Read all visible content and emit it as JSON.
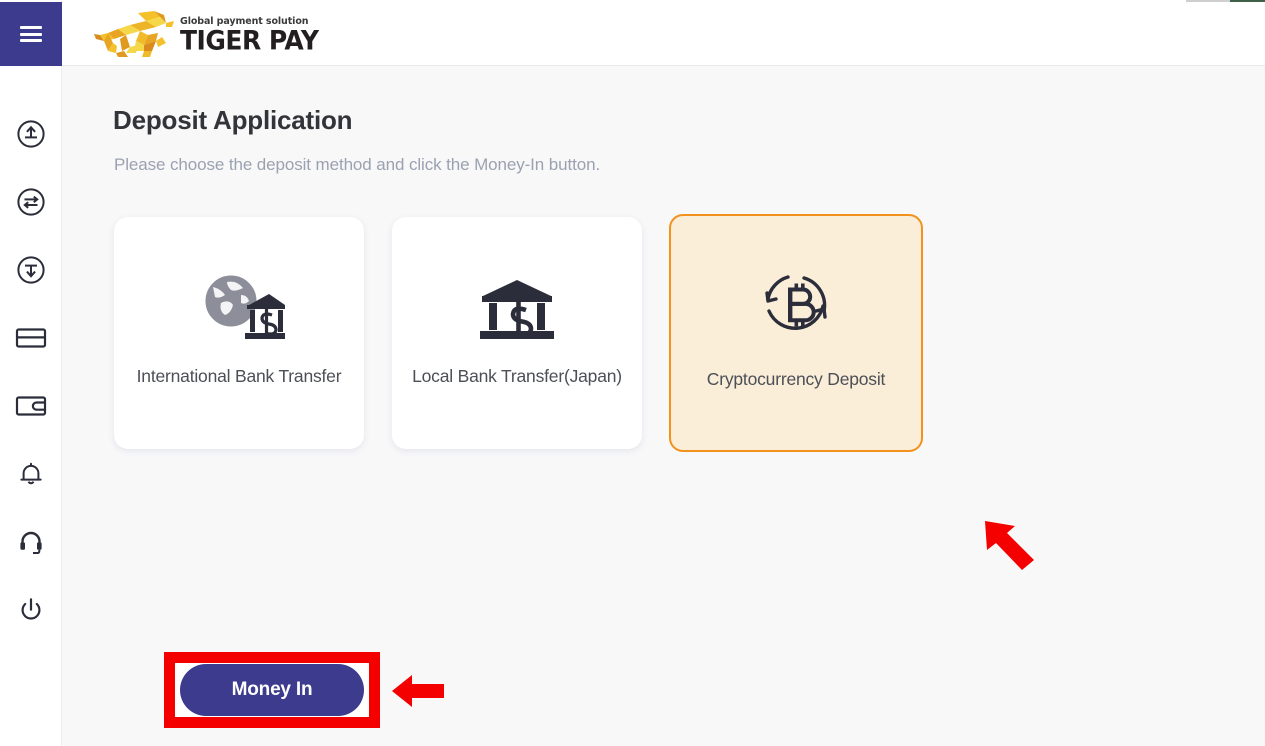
{
  "brand": {
    "tagline": "Global payment solution",
    "name": "TIGER PAY",
    "logo_icon": "tiger-logo-icon",
    "colors": {
      "tiger_light": "#f7d33c",
      "tiger_dark": "#d98b1d",
      "text": "#231f20"
    }
  },
  "colors": {
    "sidebar_accent": "#3d3b8e",
    "page_background": "#f8f8f9",
    "selected_card_border": "#f2921d",
    "selected_card_background": "#fbeed9",
    "annotation_red": "#f50000",
    "primary_button": "#3d3b8e"
  },
  "topbar": {
    "menu_toggle_label": "Menu",
    "menu_icon": "hamburger-icon"
  },
  "sidebar": {
    "items": [
      {
        "label": "Deposit",
        "icon": "arrow-up-circle-icon"
      },
      {
        "label": "Exchange",
        "icon": "exchange-circle-icon"
      },
      {
        "label": "Withdraw",
        "icon": "arrow-down-circle-icon"
      },
      {
        "label": "Cards",
        "icon": "credit-card-icon"
      },
      {
        "label": "Wallet",
        "icon": "wallet-icon"
      },
      {
        "label": "Notifications",
        "icon": "bell-icon"
      },
      {
        "label": "Support",
        "icon": "headset-icon"
      },
      {
        "label": "Logout",
        "icon": "power-icon"
      }
    ]
  },
  "main": {
    "title": "Deposit Application",
    "subtitle": "Please choose the deposit method and click the Money-In button.",
    "methods": [
      {
        "label": "International Bank Transfer",
        "icon": "globe-bank-icon",
        "selected": false
      },
      {
        "label": "Local Bank Transfer(Japan)",
        "icon": "bank-icon",
        "selected": false
      },
      {
        "label": "Cryptocurrency Deposit",
        "icon": "bitcoin-refresh-icon",
        "selected": true
      }
    ],
    "submit_label": "Money In"
  },
  "annotations": [
    {
      "type": "highlight-box",
      "target": "money-in-button"
    },
    {
      "type": "arrow-left",
      "target": "money-in-button"
    },
    {
      "type": "arrow-up-left",
      "target": "cryptocurrency-deposit-card"
    }
  ]
}
